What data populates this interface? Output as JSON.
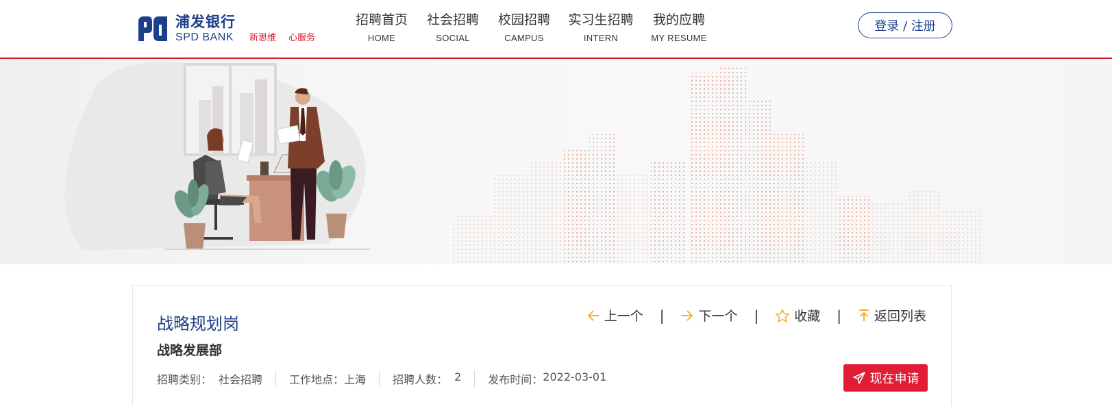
{
  "brand": {
    "name_cn": "浦发银行",
    "name_en": "SPD BANK",
    "slogans": [
      "新思维",
      "心服务"
    ],
    "primary_color": "#1c3f8c",
    "accent_color": "#d5192f"
  },
  "nav": {
    "items": [
      {
        "cn": "招聘首页",
        "en": "HOME"
      },
      {
        "cn": "社会招聘",
        "en": "SOCIAL"
      },
      {
        "cn": "校园招聘",
        "en": "CAMPUS"
      },
      {
        "cn": "实习生招聘",
        "en": "INTERN"
      },
      {
        "cn": "我的应聘",
        "en": "MY RESUME"
      }
    ],
    "login_label": "登录 / 注册"
  },
  "job": {
    "title": "战略规划岗",
    "department": "战略发展部",
    "actions": {
      "prev": "上一个",
      "next": "下一个",
      "favorite": "收藏",
      "back": "返回列表",
      "separator": "|"
    },
    "meta": [
      {
        "label": "招聘类别：",
        "value": "社会招聘"
      },
      {
        "label": "工作地点：",
        "value": "上海"
      },
      {
        "label": "招聘人数：",
        "value": "2"
      },
      {
        "label": "发布时间：",
        "value": "2022-03-01"
      }
    ],
    "apply_label": "现在申请",
    "icon_color": "#f0b429"
  }
}
